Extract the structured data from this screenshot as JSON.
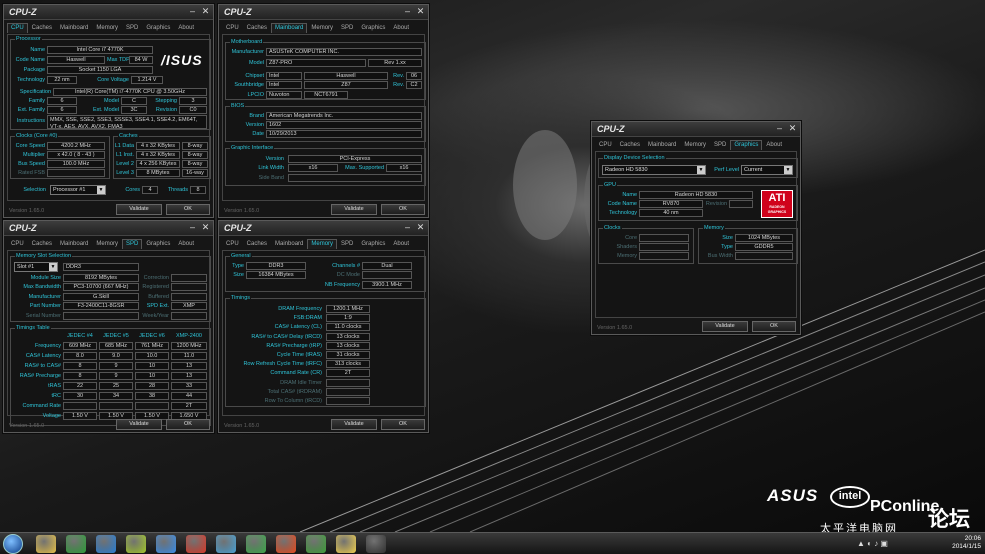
{
  "app_title": "CPU-Z",
  "version": "Version 1.65.0",
  "buttons": {
    "validate": "Validate",
    "ok": "OK"
  },
  "tabs": [
    "CPU",
    "Caches",
    "Mainboard",
    "Memory",
    "SPD",
    "Graphics",
    "About"
  ],
  "cpu": {
    "processor_legend": "Processor",
    "name_lbl": "Name",
    "name": "Intel Core i7 4770K",
    "codename_lbl": "Code Name",
    "codename": "Haswell",
    "maxtdp_lbl": "Max TDP",
    "maxtdp": "84 W",
    "package_lbl": "Package",
    "package": "Socket 1150 LGA",
    "technology_lbl": "Technology",
    "technology": "22 nm",
    "corevoltage_lbl": "Core Voltage",
    "corevoltage": "1.214 V",
    "spec_lbl": "Specification",
    "spec": "Intel(R) Core(TM) i7-4770K CPU @ 3.50GHz",
    "family_lbl": "Family",
    "family": "6",
    "model_lbl": "Model",
    "model": "C",
    "stepping_lbl": "Stepping",
    "stepping": "3",
    "extfamily_lbl": "Ext. Family",
    "extfamily": "6",
    "extmodel_lbl": "Ext. Model",
    "extmodel": "3C",
    "revision_lbl": "Revision",
    "revision": "C0",
    "instr_lbl": "Instructions",
    "instructions": "MMX, SSE, SSE2, SSE3, SSSE3, SSE4.1, SSE4.2, EM64T, VT-x, AES, AVX, AVX2, FMA3",
    "clocks_legend": "Clocks (Core #0)",
    "corespeed_lbl": "Core Speed",
    "corespeed": "4200.2 MHz",
    "multiplier_lbl": "Multiplier",
    "multiplier": "x 42.0 ( 8 - 43 )",
    "busspeed_lbl": "Bus Speed",
    "busspeed": "100.0 MHz",
    "ratedfsb_lbl": "Rated FSB",
    "caches_legend": "Caches",
    "l1d_lbl": "L1 Data",
    "l1d": "4 x 32 KBytes",
    "l1d_way": "8-way",
    "l1i_lbl": "L1 Inst.",
    "l1i": "4 x 32 KBytes",
    "l1i_way": "8-way",
    "l2_lbl": "Level 2",
    "l2": "4 x 256 KBytes",
    "l2_way": "8-way",
    "l3_lbl": "Level 3",
    "l3": "8 MBytes",
    "l3_way": "16-way",
    "selection_lbl": "Selection",
    "selection": "Processor #1",
    "cores_lbl": "Cores",
    "cores": "4",
    "threads_lbl": "Threads",
    "threads": "8"
  },
  "mainboard": {
    "mb_legend": "Motherboard",
    "manufacturer_lbl": "Manufacturer",
    "manufacturer": "ASUSTeK COMPUTER INC.",
    "model_lbl": "Model",
    "model": "Z87-PRO",
    "model_rev": "Rev 1.xx",
    "chipset_lbl": "Chipset",
    "chipset_vendor": "Intel",
    "chipset": "Haswell",
    "rev_lbl": "Rev.",
    "chipset_rev": "06",
    "southbridge_lbl": "Southbridge",
    "sb_vendor": "Intel",
    "southbridge": "Z87",
    "sb_rev": "C2",
    "lpcio_lbl": "LPCIO",
    "lpcio_vendor": "Nuvoton",
    "lpcio": "NCT6791",
    "bios_legend": "BIOS",
    "brand_lbl": "Brand",
    "brand": "American Megatrends Inc.",
    "version_lbl": "Version",
    "bios_version": "1602",
    "date_lbl": "Date",
    "bios_date": "10/29/2013",
    "gi_legend": "Graphic Interface",
    "gi_version_lbl": "Version",
    "gi_version": "PCI-Express",
    "linkwidth_lbl": "Link Width",
    "linkwidth": "x16",
    "maxsupported_lbl": "Max. Supported",
    "maxsupported": "x16",
    "sideband_lbl": "Side Band"
  },
  "spd": {
    "slot_legend": "Memory Slot Selection",
    "slot": "Slot #1",
    "type": "DDR3",
    "modulesize_lbl": "Module Size",
    "modulesize": "8192 MBytes",
    "maxbw_lbl": "Max Bandwidth",
    "maxbw": "PC3-10700 (667 MHz)",
    "manufacturer_lbl": "Manufacturer",
    "manufacturer": "G.Skill",
    "partnumber_lbl": "Part Number",
    "partnumber": "F3-2400C11-8GSR",
    "serial_lbl": "Serial Number",
    "correction_lbl": "Correction",
    "registered_lbl": "Registered",
    "buffered_lbl": "Buffered",
    "spdext_lbl": "SPD Ext.",
    "spdext": "XMP",
    "weekyear_lbl": "Week/Year",
    "timings_legend": "Timings Table",
    "headers": [
      "JEDEC #4",
      "JEDEC #5",
      "JEDEC #6",
      "XMP-2400"
    ],
    "rows": [
      {
        "label": "Frequency",
        "values": [
          "609 MHz",
          "685 MHz",
          "761 MHz",
          "1200 MHz"
        ]
      },
      {
        "label": "CAS# Latency",
        "values": [
          "8.0",
          "9.0",
          "10.0",
          "11.0"
        ]
      },
      {
        "label": "RAS# to CAS#",
        "values": [
          "8",
          "9",
          "10",
          "13"
        ]
      },
      {
        "label": "RAS# Precharge",
        "values": [
          "8",
          "9",
          "10",
          "13"
        ]
      },
      {
        "label": "tRAS",
        "values": [
          "22",
          "25",
          "28",
          "33"
        ]
      },
      {
        "label": "tRC",
        "values": [
          "30",
          "34",
          "38",
          "44"
        ]
      },
      {
        "label": "Command Rate",
        "values": [
          "",
          "",
          "",
          "2T"
        ]
      },
      {
        "label": "Voltage",
        "values": [
          "1.50 V",
          "1.50 V",
          "1.50 V",
          "1.650 V"
        ]
      }
    ]
  },
  "memory": {
    "general_legend": "General",
    "type_lbl": "Type",
    "type": "DDR3",
    "channels_lbl": "Channels #",
    "channels": "Dual",
    "size_lbl": "Size",
    "size": "16384 MBytes",
    "dcmode_lbl": "DC Mode",
    "nbfreq_lbl": "NB Frequency",
    "nbfreq": "3900.1 MHz",
    "timings_legend": "Timings",
    "rows": [
      {
        "label": "DRAM Frequency",
        "value": "1200.1 MHz"
      },
      {
        "label": "FSB:DRAM",
        "value": "1:9"
      },
      {
        "label": "CAS# Latency (CL)",
        "value": "11.0 clocks"
      },
      {
        "label": "RAS# to CAS# Delay (tRCD)",
        "value": "13 clocks"
      },
      {
        "label": "RAS# Precharge (tRP)",
        "value": "13 clocks"
      },
      {
        "label": "Cycle Time (tRAS)",
        "value": "31 clocks"
      },
      {
        "label": "Row Refresh Cycle Time (tRFC)",
        "value": "313 clocks"
      },
      {
        "label": "Command Rate (CR)",
        "value": "2T"
      },
      {
        "label": "DRAM Idle Timer",
        "value": ""
      },
      {
        "label": "Total CAS# (tRDRAM)",
        "value": ""
      },
      {
        "label": "Row To Column (tRCD)",
        "value": ""
      }
    ]
  },
  "graphics": {
    "display_legend": "Display Device Selection",
    "device": "Radeon HD 5830",
    "perflevel_lbl": "Perf Level",
    "perflevel": "Current",
    "gpu_legend": "GPU",
    "name_lbl": "Name",
    "name": "Radeon HD 5830",
    "codename_lbl": "Code Name",
    "codename": "RV870",
    "revision_lbl": "Revision",
    "technology_lbl": "Technology",
    "technology": "40 nm",
    "clocks_legend": "Clocks",
    "core_lbl": "Core",
    "shaders_lbl": "Shaders",
    "memory_lbl": "Memory",
    "mem_legend": "Memory",
    "size_lbl": "Size",
    "size": "1024 MBytes",
    "type_lbl": "Type",
    "type": "GDDR5",
    "buswidth_lbl": "Bus Width",
    "ati_top": "ATI",
    "ati_bottom": "RADEON GRAPHICS"
  },
  "desktop": {
    "asus": "ASUS",
    "intel": "intel",
    "pconline": "PConline",
    "pconline_cn": "太平洋电脑网",
    "luntan": "论坛"
  },
  "taskbar": {
    "time": "20:06",
    "date": "2014/1/15",
    "icon_colors": [
      "#e6c14a",
      "#2f9e3a",
      "#2a7fd4",
      "#a3c92c",
      "#3b8ee8",
      "#d83a2a",
      "#4aa1d4",
      "#3da84b",
      "#e64b1f",
      "#3f9f3a",
      "#f0d050",
      "#333333"
    ]
  }
}
